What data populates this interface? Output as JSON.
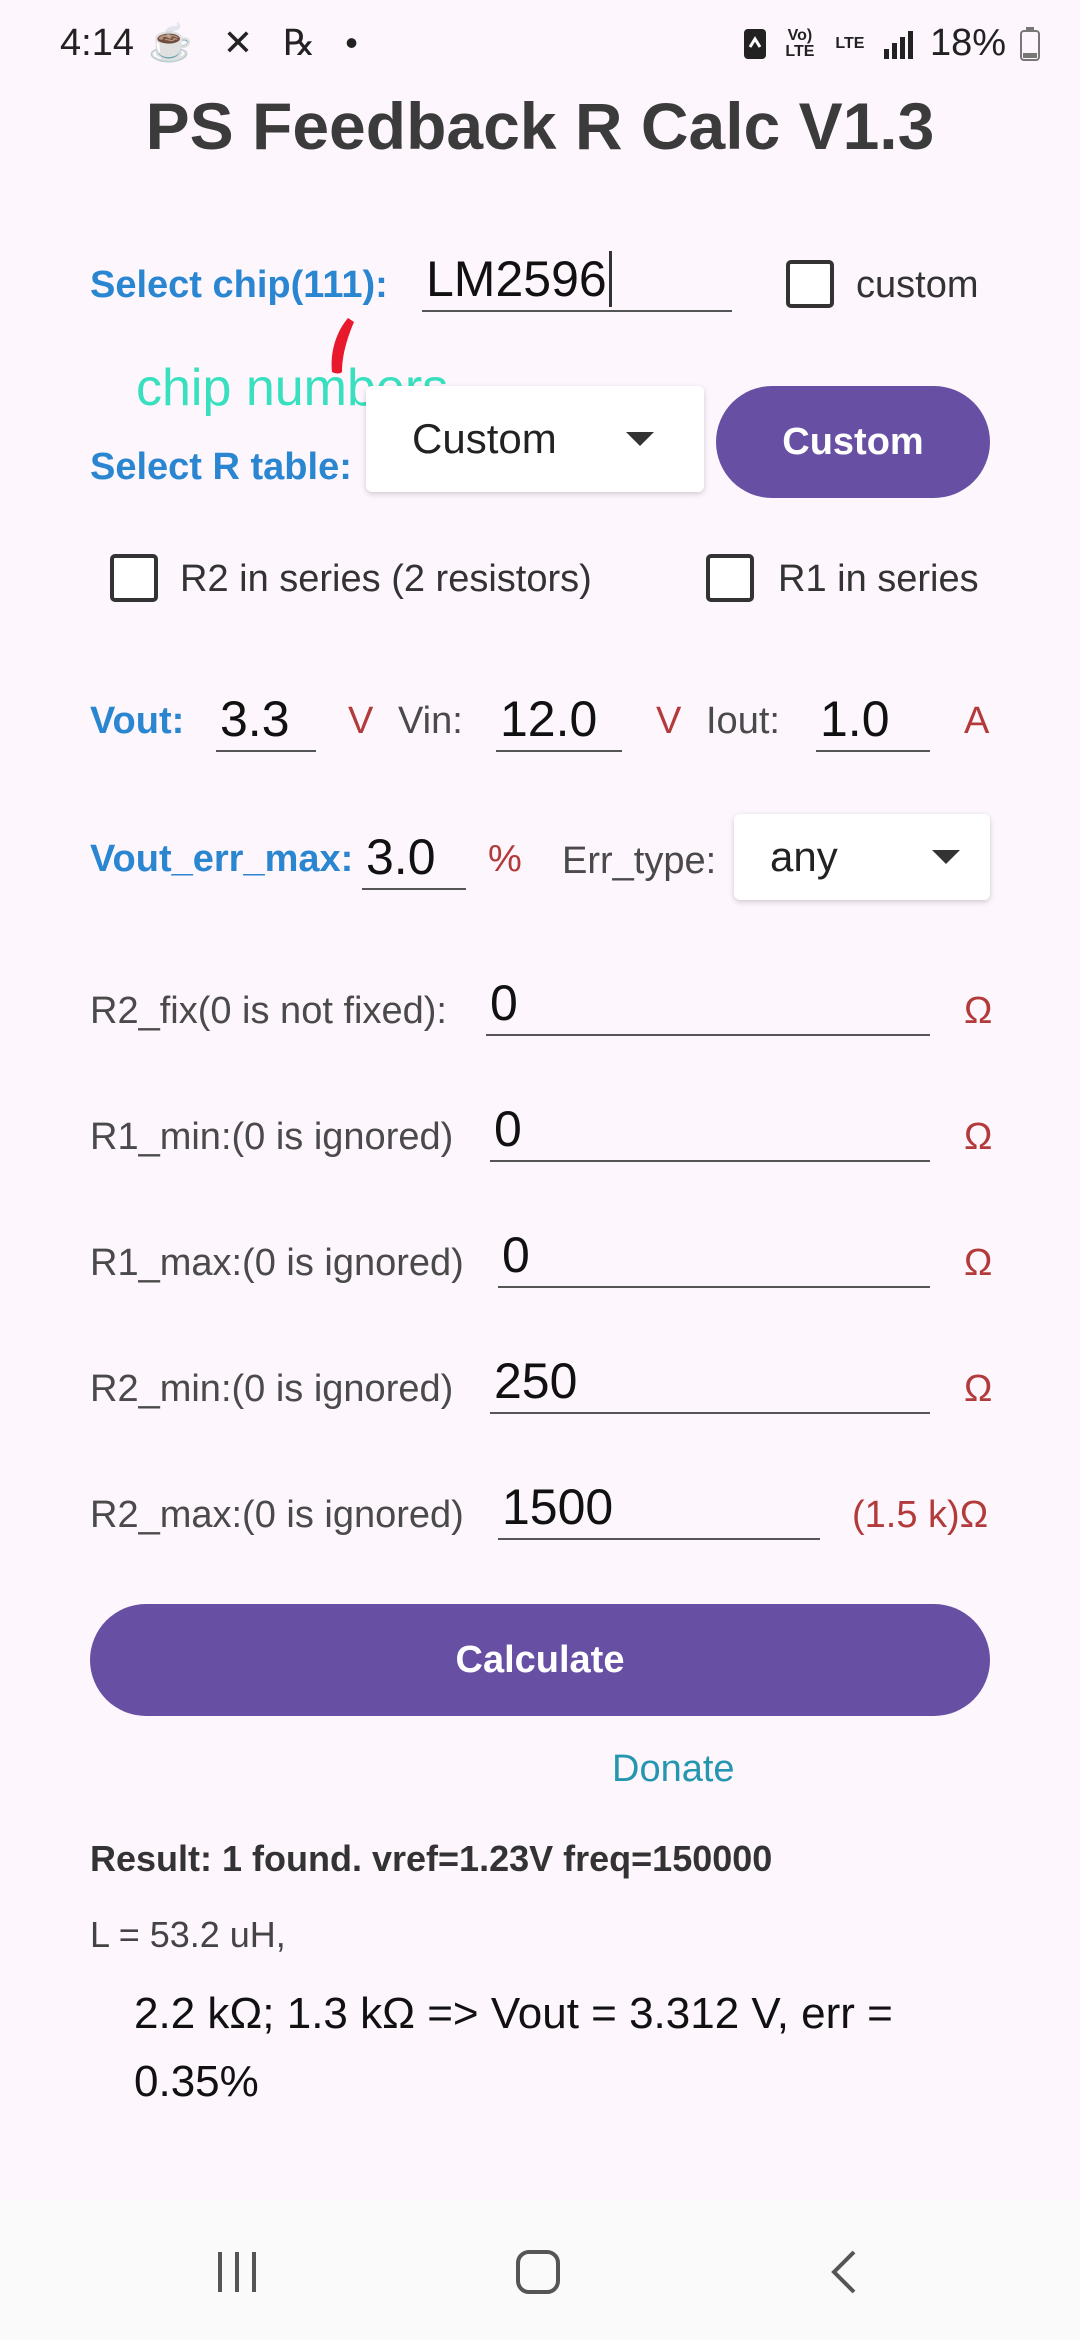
{
  "status_bar": {
    "time": "4:14",
    "notifications": "☕ ✕ ℞ •",
    "volte": "Vo) LTE",
    "lte": "LTE",
    "battery": "18%"
  },
  "title": "PS Feedback R Calc V1.3",
  "chip": {
    "label": "Select chip(111):",
    "value": "LM2596",
    "custom_label": "custom"
  },
  "annotation": "chip numbers",
  "r_table": {
    "label": "Select R table:",
    "selected": "Custom",
    "button_label": "Custom"
  },
  "series": {
    "r2_label": "R2 in series (2 resistors)",
    "r1_label": "R1 in series"
  },
  "voltage": {
    "vout_label": "Vout:",
    "vout_value": "3.3",
    "vout_unit": "V",
    "vin_label": "Vin:",
    "vin_value": "12.0",
    "vin_unit": "V",
    "iout_label": "Iout:",
    "iout_value": "1.0",
    "iout_unit": "A"
  },
  "error": {
    "label": "Vout_err_max:",
    "value": "3.0",
    "unit": "%",
    "type_label": "Err_type:",
    "type_value": "any"
  },
  "params": [
    {
      "label": "R2_fix(0 is not fixed):",
      "value": "0",
      "unit": "Ω"
    },
    {
      "label": "R1_min:(0 is ignored)",
      "value": "0",
      "unit": "Ω"
    },
    {
      "label": "R1_max:(0 is ignored)",
      "value": "0",
      "unit": "Ω"
    },
    {
      "label": "R2_min:(0 is ignored)",
      "value": "250",
      "unit": "Ω"
    },
    {
      "label": "R2_max:(0 is ignored)",
      "value": "1500",
      "unit": "(1.5 k)Ω"
    }
  ],
  "calculate_label": "Calculate",
  "donate_label": "Donate",
  "result": {
    "summary": "Result: 1 found. vref=1.23V freq=150000",
    "inductance": "L = 53.2 uH,",
    "line": "2.2 kΩ; 1.3 kΩ => Vout = 3.312 V, err = 0.35%"
  },
  "navbar": {
    "recents_icon": "recents-icon",
    "home_icon": "home-icon",
    "back_icon": "back-icon"
  },
  "colors": {
    "primary": "#6750a4",
    "label_blue": "#2a86d0",
    "unit_red": "#b33a3a",
    "link_teal": "#2596b0",
    "annotation": "#38e0c0"
  }
}
